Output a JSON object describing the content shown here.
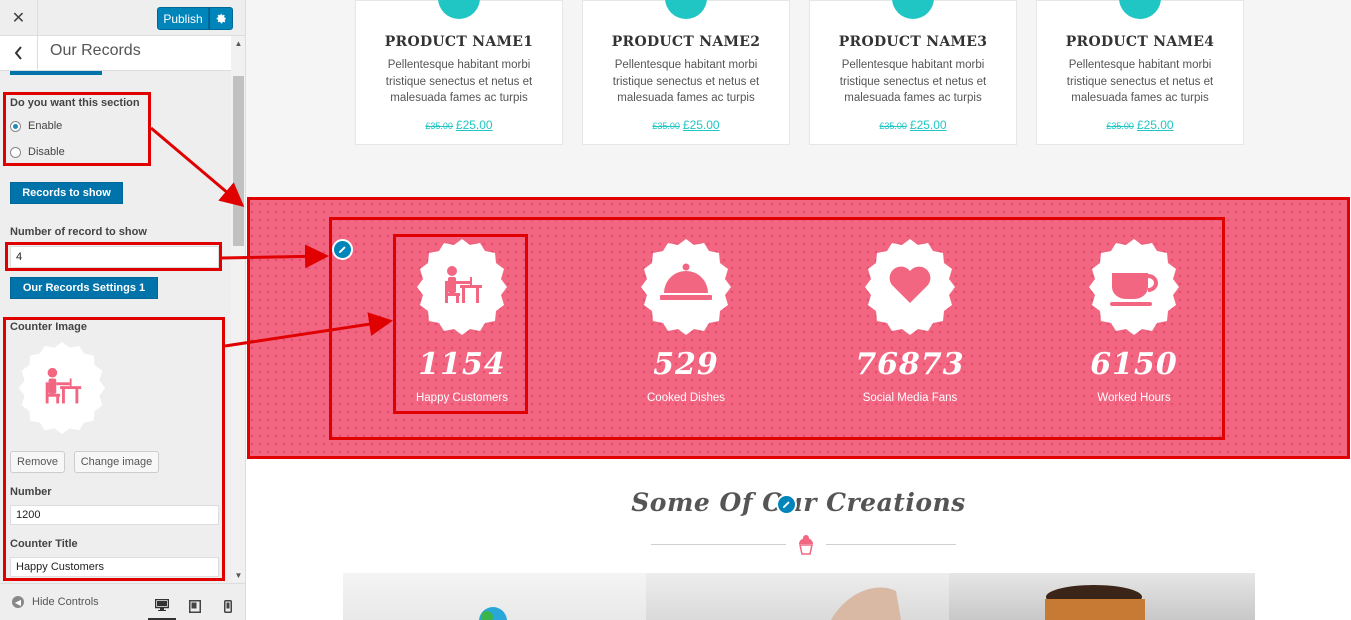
{
  "toolbar": {
    "close_icon": "close-icon",
    "publish_label": "Publish",
    "gear_icon": "gear-icon"
  },
  "panel": {
    "title": "Our Records",
    "back_icon": "chevron-left-icon"
  },
  "settings": {
    "section_question": "Do you want this section",
    "enable_label": "Enable",
    "disable_label": "Disable",
    "selected_option": "Enable",
    "records_to_show_label": "Records to show",
    "number_of_records_label": "Number of record to show",
    "number_of_records_value": "4",
    "records_settings_label": "Our Records Settings 1",
    "counter_image_label": "Counter Image",
    "remove_label": "Remove",
    "change_image_label": "Change image",
    "number_label": "Number",
    "number_value": "1200",
    "counter_title_label": "Counter Title",
    "counter_title_value": "Happy Customers"
  },
  "footer": {
    "hide_controls_label": "Hide Controls",
    "devices": [
      "desktop-icon",
      "tablet-icon",
      "mobile-icon"
    ],
    "active_device": "desktop-icon"
  },
  "products": [
    {
      "name": "PRODUCT NAME1",
      "description": "Pellentesque habitant morbi tristique senectus et netus et malesuada fames ac turpis",
      "old_price": "£35.00",
      "price": "£25.00"
    },
    {
      "name": "PRODUCT NAME2",
      "description": "Pellentesque habitant morbi tristique senectus et netus et malesuada fames ac turpis",
      "old_price": "£35.00",
      "price": "£25.00"
    },
    {
      "name": "PRODUCT NAME3",
      "description": "Pellentesque habitant morbi tristique senectus et netus et malesuada fames ac turpis",
      "old_price": "£35.00",
      "price": "£25.00"
    },
    {
      "name": "PRODUCT NAME4",
      "description": "Pellentesque habitant morbi tristique senectus et netus et malesuada fames ac turpis",
      "old_price": "£35.00",
      "price": "£25.00"
    }
  ],
  "records": [
    {
      "number": "1154",
      "title": "Happy Customers",
      "icon": "diner-icon"
    },
    {
      "number": "529",
      "title": "Cooked Dishes",
      "icon": "cloche-icon"
    },
    {
      "number": "76873",
      "title": "Social Media Fans",
      "icon": "heart-icon"
    },
    {
      "number": "6150",
      "title": "Worked Hours",
      "icon": "coffee-cup-icon"
    }
  ],
  "creations": {
    "title": "Some Of Our Creations",
    "divider_icon": "cupcake-icon"
  },
  "colors": {
    "accent": "#1fc6c4",
    "records_bg": "#f26682",
    "wp_blue": "#0073aa",
    "annotation_red": "#e00000"
  }
}
